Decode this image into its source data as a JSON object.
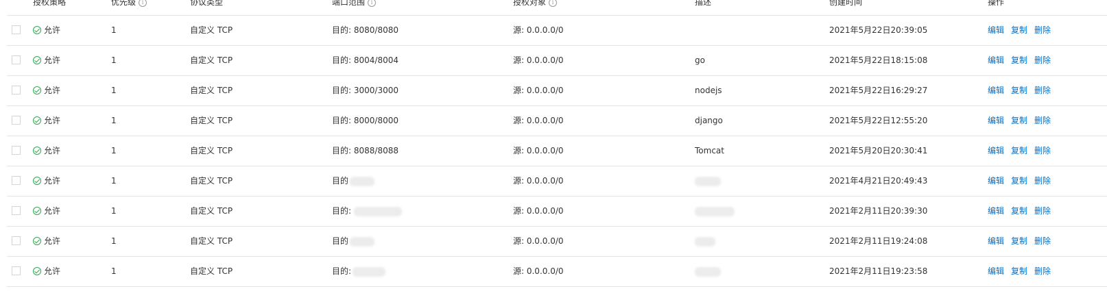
{
  "headers": {
    "policy": "授权策略",
    "priority": "优先级",
    "protocol": "协议类型",
    "port": "端口范围",
    "source": "授权对象",
    "desc": "描述",
    "time": "创建时间",
    "ops": "操作"
  },
  "actions": {
    "edit": "编辑",
    "copy": "复制",
    "delete": "删除"
  },
  "rows": [
    {
      "policy": "允许",
      "priority": "1",
      "protocol": "自定义 TCP",
      "port": "目的: 8080/8080",
      "source": "源: 0.0.0.0/0",
      "desc": "",
      "time": "2021年5月22日20:39:05"
    },
    {
      "policy": "允许",
      "priority": "1",
      "protocol": "自定义 TCP",
      "port": "目的: 8004/8004",
      "source": "源: 0.0.0.0/0",
      "desc": "go",
      "time": "2021年5月22日18:15:08"
    },
    {
      "policy": "允许",
      "priority": "1",
      "protocol": "自定义 TCP",
      "port": "目的: 3000/3000",
      "source": "源: 0.0.0.0/0",
      "desc": "nodejs",
      "time": "2021年5月22日16:29:27"
    },
    {
      "policy": "允许",
      "priority": "1",
      "protocol": "自定义 TCP",
      "port": "目的: 8000/8000",
      "source": "源: 0.0.0.0/0",
      "desc": "django",
      "time": "2021年5月22日12:55:20"
    },
    {
      "policy": "允许",
      "priority": "1",
      "protocol": "自定义 TCP",
      "port": "目的: 8088/8088",
      "source": "源: 0.0.0.0/0",
      "desc": "Tomcat",
      "time": "2021年5月20日20:30:41"
    },
    {
      "policy": "允许",
      "priority": "1",
      "protocol": "自定义 TCP",
      "port": "目的",
      "source": "源: 0.0.0.0/0",
      "desc": "",
      "time": "2021年4月21日20:49:43"
    },
    {
      "policy": "允许",
      "priority": "1",
      "protocol": "自定义 TCP",
      "port": "目的:",
      "source": "源: 0.0.0.0/0",
      "desc": "",
      "time": "2021年2月11日20:39:30"
    },
    {
      "policy": "允许",
      "priority": "1",
      "protocol": "自定义 TCP",
      "port": "目的",
      "source": "源: 0.0.0.0/0",
      "desc": "",
      "time": "2021年2月11日19:24:08"
    },
    {
      "policy": "允许",
      "priority": "1",
      "protocol": "自定义 TCP",
      "port": "目的:",
      "source": "源: 0.0.0.0/0",
      "desc": "",
      "time": "2021年2月11日19:23:58"
    }
  ]
}
